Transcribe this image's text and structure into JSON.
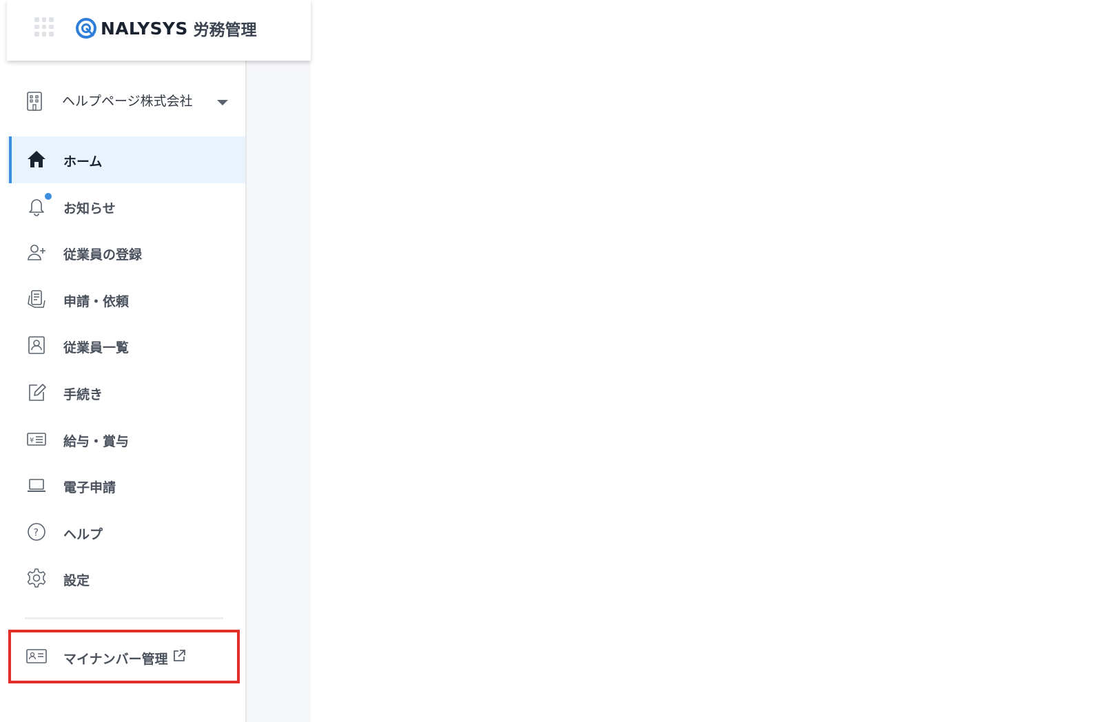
{
  "header": {
    "brand_name": "NALYSYS",
    "brand_sub": "労務管理",
    "brand_color": "#2f7fd8"
  },
  "company_selector": {
    "label": "ヘルプページ株式会社",
    "icon": "building-icon"
  },
  "nav": {
    "items": [
      {
        "label": "ホーム",
        "icon": "home-icon",
        "active": true
      },
      {
        "label": "お知らせ",
        "icon": "bell-icon",
        "badge": true
      },
      {
        "label": "従業員の登録",
        "icon": "add-user-icon"
      },
      {
        "label": "申請・依頼",
        "icon": "request-icon"
      },
      {
        "label": "従業員一覧",
        "icon": "employee-list-icon"
      },
      {
        "label": "手続き",
        "icon": "edit-icon"
      },
      {
        "label": "給与・賞与",
        "icon": "payslip-icon"
      },
      {
        "label": "電子申請",
        "icon": "laptop-icon"
      },
      {
        "label": "ヘルプ",
        "icon": "help-icon"
      },
      {
        "label": "設定",
        "icon": "gear-icon"
      }
    ]
  },
  "mynumber": {
    "label": "マイナンバー管理",
    "icon": "id-card-icon",
    "external_icon": "external-link-icon",
    "highlight_color": "#e22f2a"
  },
  "colors": {
    "accent": "#3c8fe0",
    "active_bg": "#e8f3fd",
    "text": "#4a515c"
  }
}
